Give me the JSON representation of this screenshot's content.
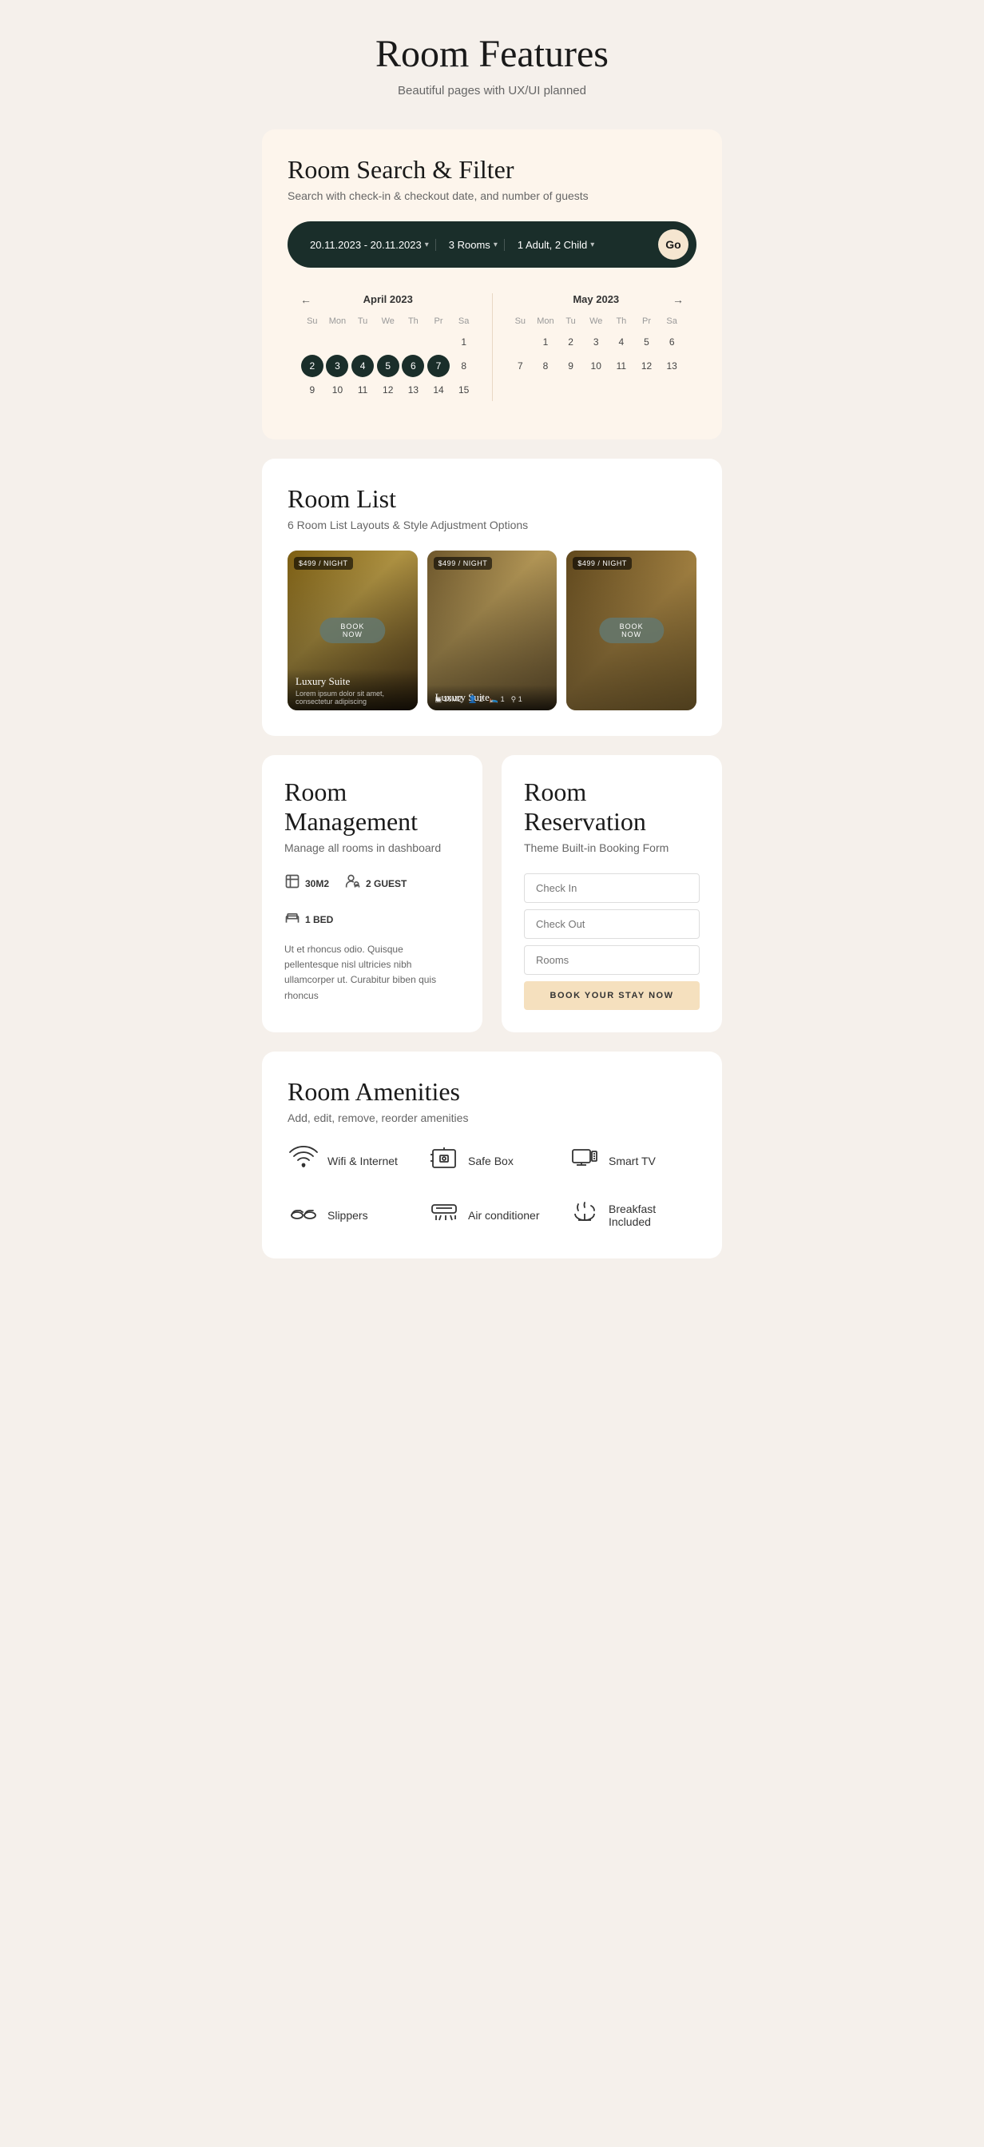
{
  "page": {
    "title": "Room Features",
    "subtitle": "Beautiful pages with UX/UI planned"
  },
  "search": {
    "section_title": "Room Search & Filter",
    "section_subtitle": "Search with check-in & checkout date, and number of guests",
    "date_range": "20.11.2023 - 20.11.2023",
    "rooms": "3 Rooms",
    "guests": "1 Adult, 2 Child",
    "go_label": "Go",
    "april": {
      "title": "April 2023",
      "days_labels": [
        "Su",
        "Mon",
        "Tu",
        "We",
        "Th",
        "Pr",
        "Sa"
      ],
      "week1": [
        "",
        "",
        "",
        "",
        "",
        "",
        "1"
      ],
      "week2": [
        "2",
        "3",
        "4",
        "5",
        "6",
        "7",
        "8"
      ],
      "week3": [
        "9",
        "10",
        "11",
        "12",
        "13",
        "14",
        "15"
      ],
      "selected": [
        "2",
        "3",
        "4",
        "5",
        "6",
        "7"
      ]
    },
    "may": {
      "title": "May 2023",
      "days_labels": [
        "Su",
        "Mon",
        "Tu",
        "We",
        "Th",
        "Pr",
        "Sa"
      ],
      "week1": [
        "",
        "1",
        "2",
        "3",
        "4",
        "5",
        "6"
      ],
      "week2": [
        "7",
        "8",
        "9",
        "10",
        "11",
        "12",
        "13"
      ],
      "selected": []
    }
  },
  "room_list": {
    "section_title": "Room List",
    "section_subtitle": "6 Room List Layouts & Style Adjustment Options",
    "rooms": [
      {
        "price": "$499 / NIGHT",
        "name": "Luxury Suite",
        "desc": "Lorem ipsum dolor sit amet, consectetur adipiscing",
        "has_book_btn": true,
        "card_style": "c1"
      },
      {
        "price": "$499 / NIGHT",
        "name": "Luxury Suite",
        "desc": "",
        "info": "30M2  ★2  ✦1  ✤1",
        "has_book_btn": false,
        "card_style": "c2"
      },
      {
        "price": "$499 / NIGHT",
        "name": "",
        "desc": "",
        "has_book_btn": true,
        "card_style": "c3"
      }
    ]
  },
  "room_management": {
    "section_title": "Room Management",
    "section_subtitle": "Manage all rooms in dashboard",
    "stats": [
      {
        "icon": "area",
        "label": "30M2"
      },
      {
        "icon": "guest",
        "label": "2 GUEST"
      },
      {
        "icon": "bed",
        "label": "1 BED"
      }
    ],
    "description": "Ut et rhoncus odio. Quisque pellentesque nisl ultricies nibh ullamcorper ut. Curabitur biben quis rhoncus"
  },
  "reservation": {
    "section_title": "Room Reservation",
    "section_subtitle": "Theme Built-in Booking Form",
    "check_in_placeholder": "Check In",
    "check_out_placeholder": "Check Out",
    "rooms_placeholder": "Rooms",
    "submit_label": "BOOK YOUR STAY NOW"
  },
  "amenities": {
    "section_title": "Room Amenities",
    "section_subtitle": "Add, edit, remove, reorder amenities",
    "items": [
      {
        "icon": "wifi",
        "label": "Wifi & Internet"
      },
      {
        "icon": "safe",
        "label": "Safe Box"
      },
      {
        "icon": "tv",
        "label": "Smart TV"
      },
      {
        "icon": "slippers",
        "label": "Slippers"
      },
      {
        "icon": "ac",
        "label": "Air conditioner"
      },
      {
        "icon": "breakfast",
        "label": "Breakfast Included"
      }
    ]
  }
}
